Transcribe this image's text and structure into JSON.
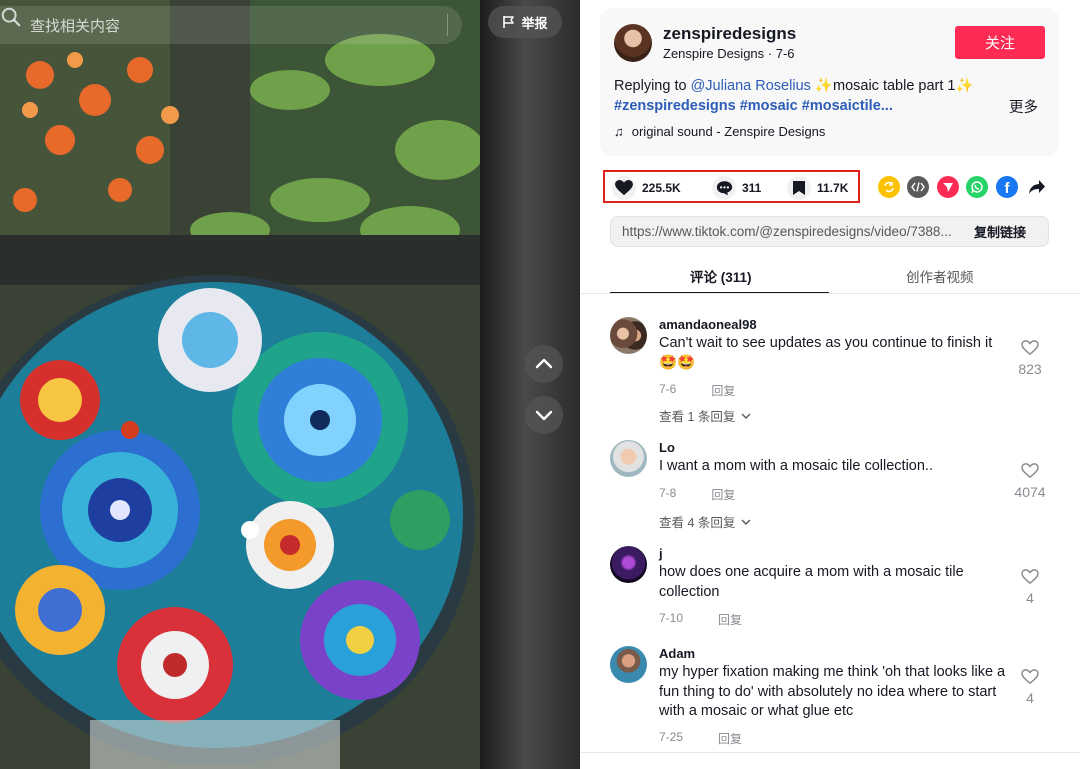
{
  "video": {
    "search_placeholder": "查找相关内容",
    "report_label": "举报"
  },
  "author": {
    "handle": "zenspiredesigns",
    "subtitle": "Zenspire Designs · 7-6",
    "follow_label": "关注",
    "reply_prefix": "Replying to ",
    "reply_target": "@Juliana Roselius",
    "caption": "mosaic table part 1",
    "hashtags": "#zenspiredesigns #mosaic #mosaictile...",
    "more_label": "更多",
    "music": "original sound - Zenspire Designs"
  },
  "stats": {
    "likes": "225.5K",
    "comments": "311",
    "saves": "11.7K"
  },
  "share": {
    "icons": [
      "repost-icon",
      "embed-icon",
      "send-icon",
      "whatsapp-icon",
      "facebook-icon",
      "share-arrow-icon"
    ],
    "colors": [
      "#fcc200",
      "#5b5b5b",
      "#fe2c55",
      "#25d366",
      "#1877f2",
      "#161823"
    ]
  },
  "link": {
    "url": "https://www.tiktok.com/@zenspiredesigns/video/7388...",
    "copy_label": "复制链接"
  },
  "tabs": {
    "comments": "评论 (311)",
    "creator_videos": "创作者视频"
  },
  "comments": [
    {
      "user": "amandaoneal98",
      "text": "Can't wait to see updates as you continue to finish it 🤩🤩",
      "date": "7-6",
      "reply_label": "回复",
      "likes": "823",
      "view_replies": "查看 1 条回复"
    },
    {
      "user": "Lo",
      "text": "I want a mom with a mosaic tile collection..",
      "date": "7-8",
      "reply_label": "回复",
      "likes": "4074",
      "view_replies": "查看 4 条回复"
    },
    {
      "user": "j",
      "text": "how does one acquire a mom with a mosaic tile collection",
      "date": "7-10",
      "reply_label": "回复",
      "likes": "4"
    },
    {
      "user": "Adam",
      "text": "my hyper fixation making me think 'oh that looks like a fun thing to do' with absolutely no idea where to start with a mosaic or what glue etc",
      "date": "7-25",
      "reply_label": "回复",
      "likes": "4"
    }
  ],
  "colors": {
    "accent": "#fe2c55",
    "link": "#2b5db9",
    "highlight_border": "#e0201d"
  }
}
